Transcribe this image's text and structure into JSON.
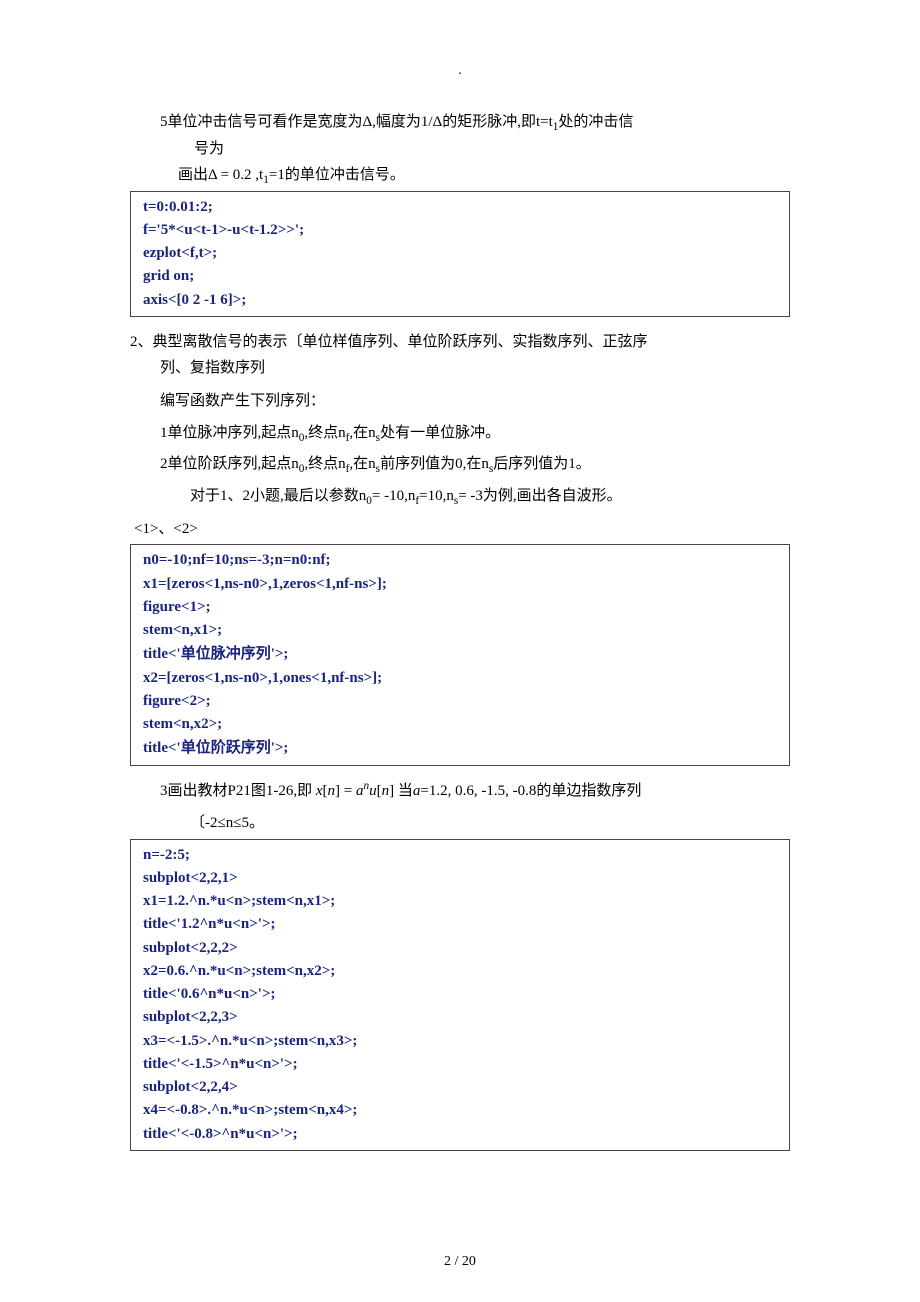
{
  "header_dot": ".",
  "p1_line1_a": "5单位冲击信号可看作是宽度为",
  "p1_delta1": "Δ",
  "p1_line1_b": ",幅度为1/",
  "p1_delta2": "Δ",
  "p1_line1_c": "的矩形脉冲,即t=t",
  "p1_sub1": "1",
  "p1_line1_d": "处的冲击信",
  "p1_line2": "号为",
  "p1_line3_a": "画出",
  "p1_delta3": "Δ",
  "p1_line3_b": " = 0.2 ,t",
  "p1_sub2": "1",
  "p1_line3_c": "=1的单位冲击信号。",
  "code1": {
    "l1": "t=0:0.01:2;",
    "l2": "f='5*<u<t-1>-u<t-1.2>>';",
    "l3": "ezplot<f,t>;",
    "l4": "grid on;",
    "l5": "axis<[0 2 -1 6]>;"
  },
  "sec2_a": "2、典型离散信号的表示〔单位样值序列、单位阶跃序列、实指数序列、正弦序",
  "sec2_b": "列、复指数序列",
  "sec2_c": "编写函数产生下列序列：",
  "q1_a": "1单位脉冲序列,起点n",
  "q1_s0": "0",
  "q1_b": ",终点n",
  "q1_sf": "f",
  "q1_c": ",在n",
  "q1_ss": "s",
  "q1_d": "处有一单位脉冲。",
  "q2_a": "2单位阶跃序列,起点n",
  "q2_s0": "0",
  "q2_b": ",终点n",
  "q2_sf": "f",
  "q2_c": ",在n",
  "q2_ss1": "s",
  "q2_d": "前序列值为0,在n",
  "q2_ss2": "s",
  "q2_e": "后序列值为1。",
  "note_a": "对于1、2小题,最后以参数n",
  "note_s0": "0",
  "note_b": "= -10,n",
  "note_sf": "f",
  "note_c": "=10,n",
  "note_ss": "s",
  "note_d": "= -3为例,画出各自波形。",
  "label12": "<1>、<2>",
  "code2": {
    "l1": "n0=-10;nf=10;ns=-3;n=n0:nf;",
    "l2": "x1=[zeros<1,ns-n0>,1,zeros<1,nf-ns>];",
    "l3": "figure<1>;",
    "l4": "stem<n,x1>;",
    "l5a": "title<'",
    "l5b": "单位脉冲序列",
    "l5c": "'>;",
    "l6": "x2=[zeros<1,ns-n0>,1,ones<1,nf-ns>];",
    "l7": "figure<2>;",
    "l8": "stem<n,x2>;",
    "l9a": "title<'",
    "l9b": "单位阶跃序列",
    "l9c": "'>;"
  },
  "q3_a": "3画出教材P21图1-26,即 ",
  "q3_x": "x",
  "q3_lb1": "[",
  "q3_n1": "n",
  "q3_rb1": "] = ",
  "q3_a2": "a",
  "q3_exp": "n",
  "q3_u": "u",
  "q3_lb2": "[",
  "q3_n2": "n",
  "q3_rb2": "]",
  "q3_b": " 当",
  "q3_a3": "a",
  "q3_c": "=1.2, 0.6, -1.5, -0.8的单边指数序列",
  "q3_d": "〔-2≤n≤5。",
  "code3": {
    "l1": "n=-2:5;",
    "l2": "subplot<2,2,1>",
    "l3": "x1=1.2.^n.*u<n>;stem<n,x1>;",
    "l4": "title<'1.2^n*u<n>'>;",
    "l5": "subplot<2,2,2>",
    "l6": "x2=0.6.^n.*u<n>;stem<n,x2>;",
    "l7": "title<'0.6^n*u<n>'>;",
    "l8": "subplot<2,2,3>",
    "l9": "x3=<-1.5>.^n.*u<n>;stem<n,x3>;",
    "l10": "title<'<-1.5>^n*u<n>'>;",
    "l11": "subplot<2,2,4>",
    "l12": "x4=<-0.8>.^n.*u<n>;stem<n,x4>;",
    "l13": "title<'<-0.8>^n*u<n>'>;"
  },
  "footer": "2  /  20"
}
